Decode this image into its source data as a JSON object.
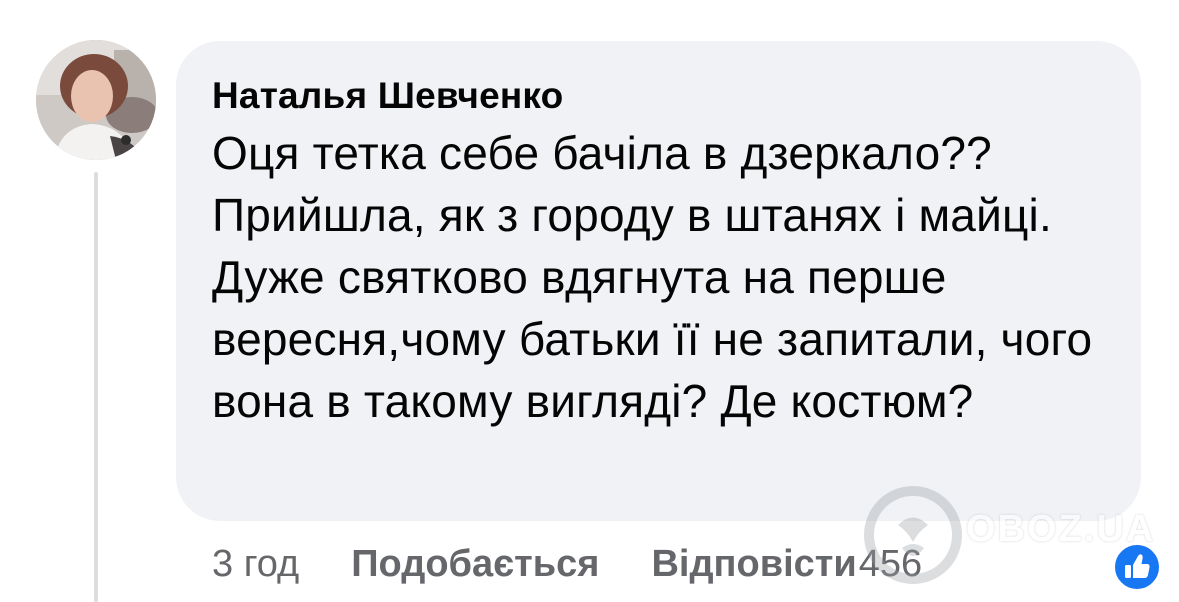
{
  "comment": {
    "author": "Наталья Шевченко",
    "text": "Оця тетка себе бачіла в дзеркало?? Прийшла, як з городу в штанях і майці. Дуже святково вдягнута на перше вересня,чому батьки її не запитали, чого вона в такому вигляді? Де костюм?"
  },
  "actions": {
    "time": "3 год",
    "like_label": "Подобається",
    "reply_label": "Відповісти",
    "reaction_count": "456"
  },
  "icons": {
    "reaction": "like-thumb-icon",
    "watermark": "obozrevatel-logo"
  },
  "watermark": {
    "text": "OBOZ.UA"
  },
  "colors": {
    "bubble": "#f0f2f5",
    "author": "#050505",
    "secondary_text": "#65676b",
    "like_blue": "#1877f2"
  }
}
